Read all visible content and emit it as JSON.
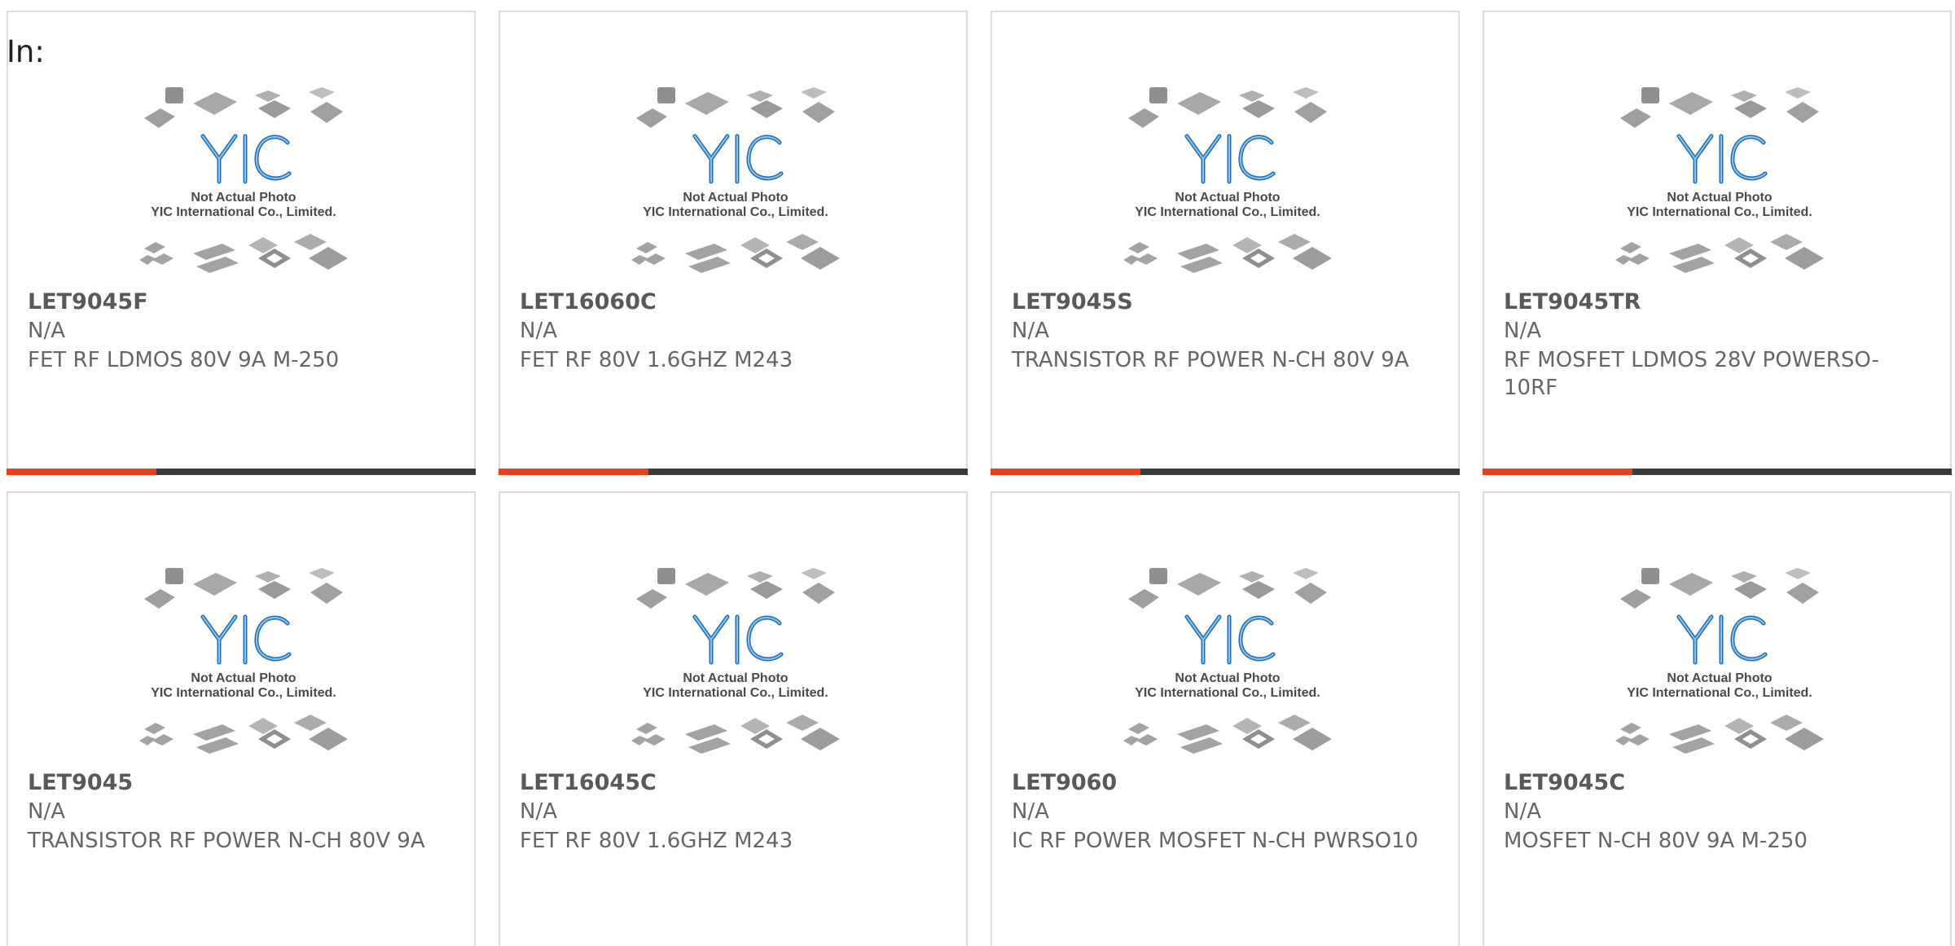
{
  "header": {
    "in_label": "In:"
  },
  "colors": {
    "accent": "#e8401c",
    "bar_dark": "#3b3b3b",
    "border": "#dcdcdc",
    "logo_blue": "#1e6fb3"
  },
  "placeholder": {
    "line1": "Not Actual Photo",
    "line2": "YIC International Co., Limited.",
    "logo_text": "YIC"
  },
  "products": [
    {
      "part": "LET9045F",
      "mfr": "N/A",
      "desc": "FET RF LDMOS 80V 9A M-250"
    },
    {
      "part": "LET16060C",
      "mfr": "N/A",
      "desc": "FET RF 80V 1.6GHZ M243"
    },
    {
      "part": "LET9045S",
      "mfr": "N/A",
      "desc": "TRANSISTOR RF POWER N-CH 80V 9A"
    },
    {
      "part": "LET9045TR",
      "mfr": "N/A",
      "desc": "RF MOSFET LDMOS 28V POWERSO-10RF"
    },
    {
      "part": "LET9045",
      "mfr": "N/A",
      "desc": "TRANSISTOR RF POWER N-CH 80V 9A"
    },
    {
      "part": "LET16045C",
      "mfr": "N/A",
      "desc": "FET RF 80V 1.6GHZ M243"
    },
    {
      "part": "LET9060",
      "mfr": "N/A",
      "desc": "IC RF POWER MOSFET N-CH PWRSO10"
    },
    {
      "part": "LET9045C",
      "mfr": "N/A",
      "desc": "MOSFET N-CH 80V 9A M-250"
    }
  ]
}
